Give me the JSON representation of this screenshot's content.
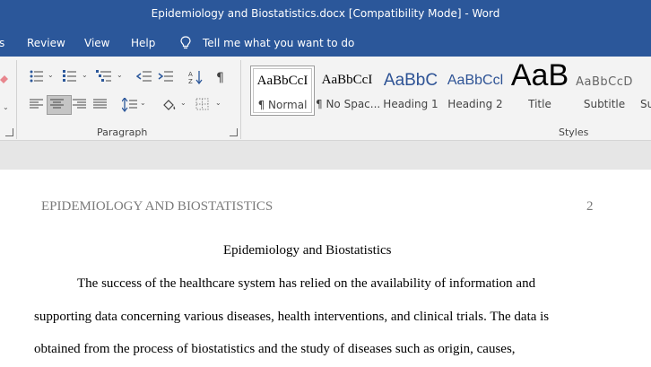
{
  "window": {
    "title": "Epidemiology and Biostatistics.docx [Compatibility Mode]  -  Word"
  },
  "menu": {
    "tabs": [
      "s",
      "Review",
      "View",
      "Help"
    ],
    "tell_me": "Tell me what you want to do"
  },
  "ribbon": {
    "paragraph_label": "Paragraph",
    "styles_label": "Styles",
    "styles": [
      {
        "sample": "AaBbCcI",
        "name": "¶ Normal"
      },
      {
        "sample": "AaBbCcI",
        "name": "¶ No Spac..."
      },
      {
        "sample": "AaBbC",
        "name": "Heading 1"
      },
      {
        "sample": "AaBbCcl",
        "name": "Heading 2"
      },
      {
        "sample": "AaB",
        "name": "Title"
      },
      {
        "sample": "AaBbCcD",
        "name": "Subtitle"
      },
      {
        "sample": "",
        "name": "Su"
      }
    ]
  },
  "document": {
    "header_title": "EPIDEMIOLOGY AND BIOSTATISTICS",
    "page_number": "2",
    "heading": "Epidemiology and Biostatistics",
    "lines": [
      "The success of the healthcare system has relied on the availability of information and",
      "supporting data concerning various diseases, health interventions, and clinical trials. The data is",
      "obtained from the process of biostatistics and the study of diseases such as origin, causes,"
    ]
  },
  "colors": {
    "word_blue": "#2b579a",
    "ribbon_bg": "#f3f3f3",
    "canvas_bg": "#e6e6e6"
  }
}
